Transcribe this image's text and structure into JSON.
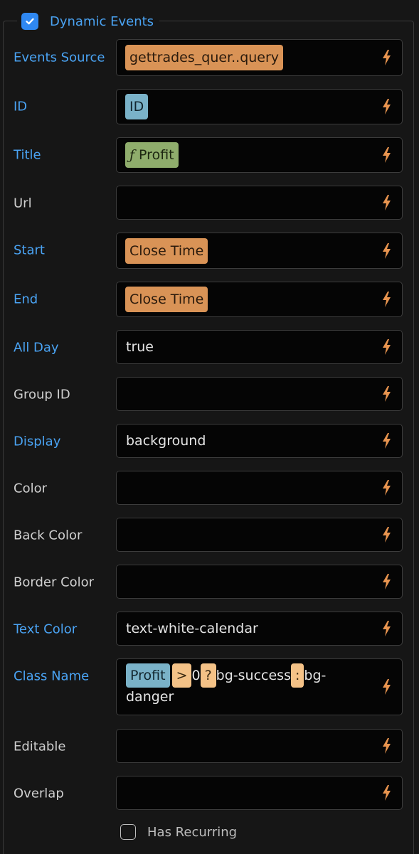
{
  "section": {
    "title": "Dynamic Events",
    "checked": true
  },
  "accent_color": "#4aa3f3",
  "bolt_color": "#e8944f",
  "fields": {
    "events_source": {
      "label": "Events Source",
      "chip": "gettrades_quer..query"
    },
    "id": {
      "label": "ID",
      "chip": "ID"
    },
    "title": {
      "label": "Title",
      "chip_prefix": "ƒ",
      "chip": "Profit"
    },
    "url": {
      "label": "Url",
      "value": ""
    },
    "start": {
      "label": "Start",
      "chip": "Close Time"
    },
    "end": {
      "label": "End",
      "chip": "Close Time"
    },
    "all_day": {
      "label": "All Day",
      "value": "true"
    },
    "group_id": {
      "label": "Group ID",
      "value": ""
    },
    "display": {
      "label": "Display",
      "value": "background"
    },
    "color": {
      "label": "Color",
      "value": ""
    },
    "back_color": {
      "label": "Back Color",
      "value": ""
    },
    "border_color": {
      "label": "Border Color",
      "value": ""
    },
    "text_color": {
      "label": "Text Color",
      "value": "text-white-calendar"
    },
    "class_name": {
      "label": "Class Name",
      "expr": {
        "chip": "Profit",
        "op_gt": ">",
        "zero": "0",
        "op_q": "?",
        "success": "bg-success",
        "op_colon": ":",
        "danger_1": "bg-",
        "danger_2": "danger"
      }
    },
    "editable": {
      "label": "Editable",
      "value": ""
    },
    "overlap": {
      "label": "Overlap",
      "value": ""
    }
  },
  "has_recurring": {
    "label": "Has Recurring",
    "checked": false
  }
}
